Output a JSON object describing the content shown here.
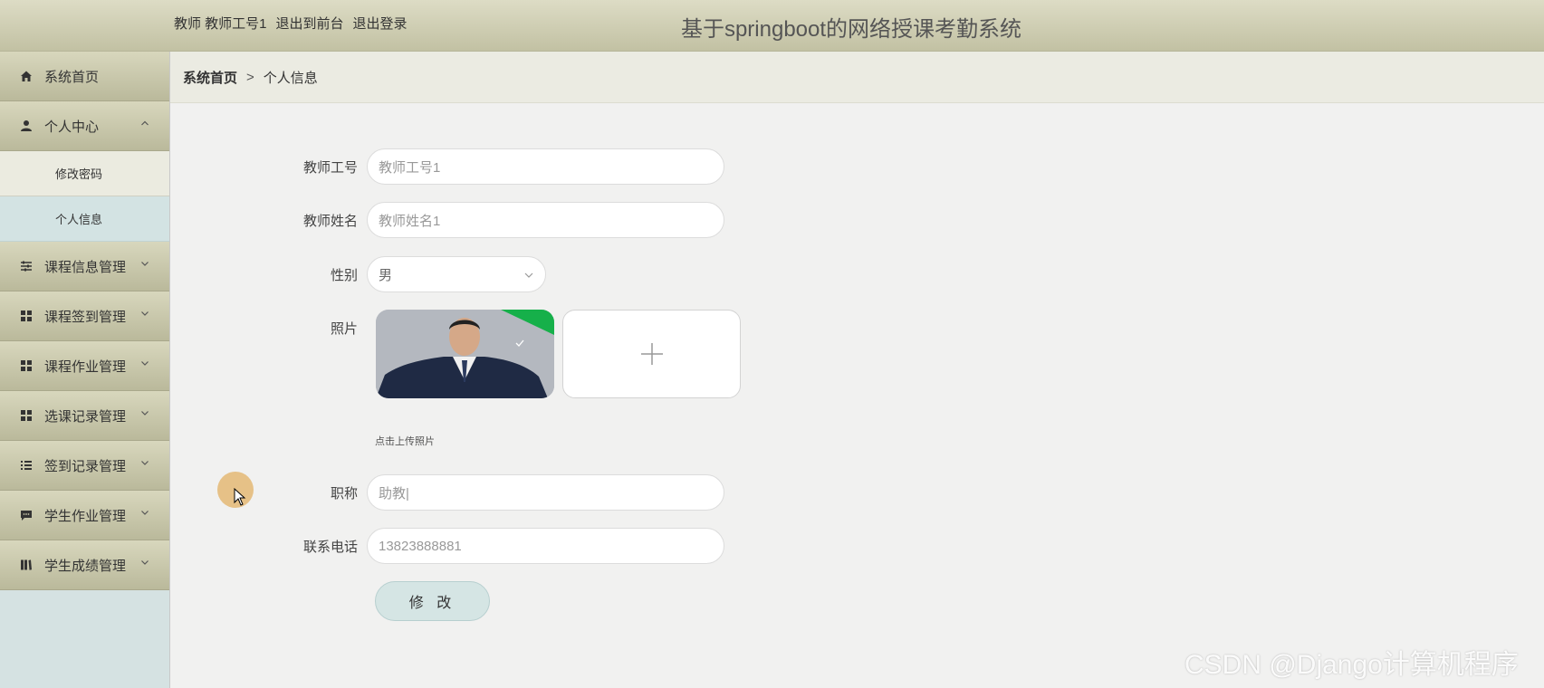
{
  "header": {
    "user_info": "教师 教师工号1",
    "to_front": "退出到前台",
    "logout": "退出登录",
    "title": "基于springboot的网络授课考勤系统"
  },
  "sidebar": {
    "items": [
      {
        "label": "系统首页",
        "icon": "home-icon"
      },
      {
        "label": "个人中心",
        "icon": "user-icon",
        "expanded": true,
        "children": [
          {
            "label": "修改密码"
          },
          {
            "label": "个人信息"
          }
        ]
      },
      {
        "label": "课程信息管理",
        "icon": "sliders-icon"
      },
      {
        "label": "课程签到管理",
        "icon": "grid-icon"
      },
      {
        "label": "课程作业管理",
        "icon": "grid-icon"
      },
      {
        "label": "选课记录管理",
        "icon": "grid-icon"
      },
      {
        "label": "签到记录管理",
        "icon": "list-icon"
      },
      {
        "label": "学生作业管理",
        "icon": "chat-icon"
      },
      {
        "label": "学生成绩管理",
        "icon": "book-icon"
      }
    ]
  },
  "breadcrumb": {
    "home": "系统首页",
    "sep": ">",
    "current": "个人信息"
  },
  "form": {
    "teacher_no": {
      "label": "教师工号",
      "value": "教师工号1"
    },
    "teacher_name": {
      "label": "教师姓名",
      "value": "教师姓名1"
    },
    "gender": {
      "label": "性别",
      "value": "男"
    },
    "photo": {
      "label": "照片",
      "tip": "点击上传照片"
    },
    "title_field": {
      "label": "职称",
      "value": "助教|"
    },
    "phone": {
      "label": "联系电话",
      "value": "13823888881"
    },
    "submit": "修 改"
  },
  "watermark": "CSDN @Django计算机程序",
  "colors": {
    "header_bg": "#cfcdb3",
    "sidebar_bg": "#d5e2e2",
    "accent_green": "#16b04a"
  }
}
